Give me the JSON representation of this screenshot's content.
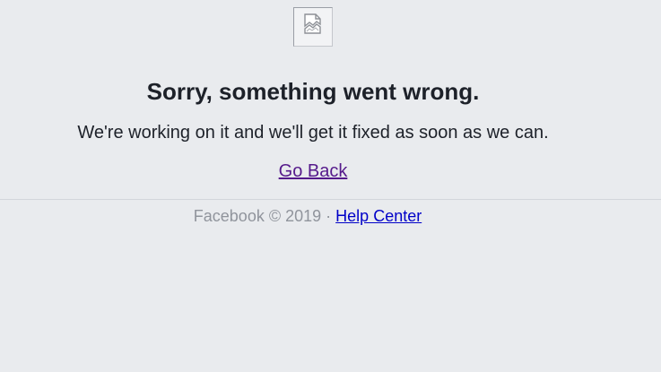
{
  "error": {
    "icon": "broken-image-icon",
    "title": "Sorry, something went wrong.",
    "message": "We're working on it and we'll get it fixed as soon as we can.",
    "back_link": "Go Back"
  },
  "footer": {
    "copyright": "Facebook © 2019",
    "separator": "·",
    "help_link": "Help Center"
  },
  "colors": {
    "background": "#e9ebee",
    "text": "#1d2129",
    "visited_link": "#551a8b",
    "link": "#0000c8",
    "muted": "#90949c"
  }
}
